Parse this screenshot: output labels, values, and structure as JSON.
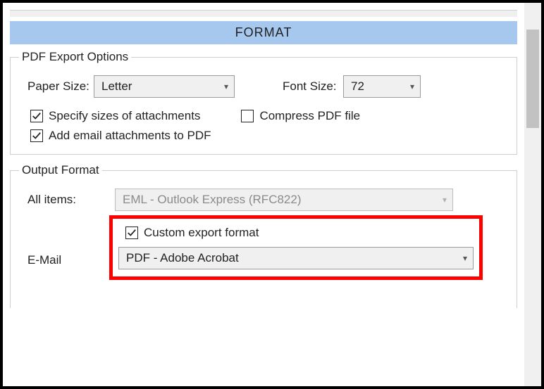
{
  "header": {
    "title": "FORMAT"
  },
  "pdf_export": {
    "legend": "PDF Export Options",
    "paper_size_label": "Paper Size:",
    "paper_size_value": "Letter",
    "font_size_label": "Font Size:",
    "font_size_value": "72",
    "cb_specify_sizes": {
      "label": "Specify sizes of attachments",
      "checked": true
    },
    "cb_compress": {
      "label": "Compress PDF file",
      "checked": false
    },
    "cb_add_attachments": {
      "label": "Add email attachments to PDF",
      "checked": true
    }
  },
  "output_format": {
    "legend": "Output Format",
    "all_items_label": "All items:",
    "all_items_value": "EML - Outlook Express (RFC822)",
    "cb_custom_export": {
      "label": "Custom export format",
      "checked": true
    },
    "email_label": "E-Mail",
    "email_value": "PDF - Adobe Acrobat"
  }
}
